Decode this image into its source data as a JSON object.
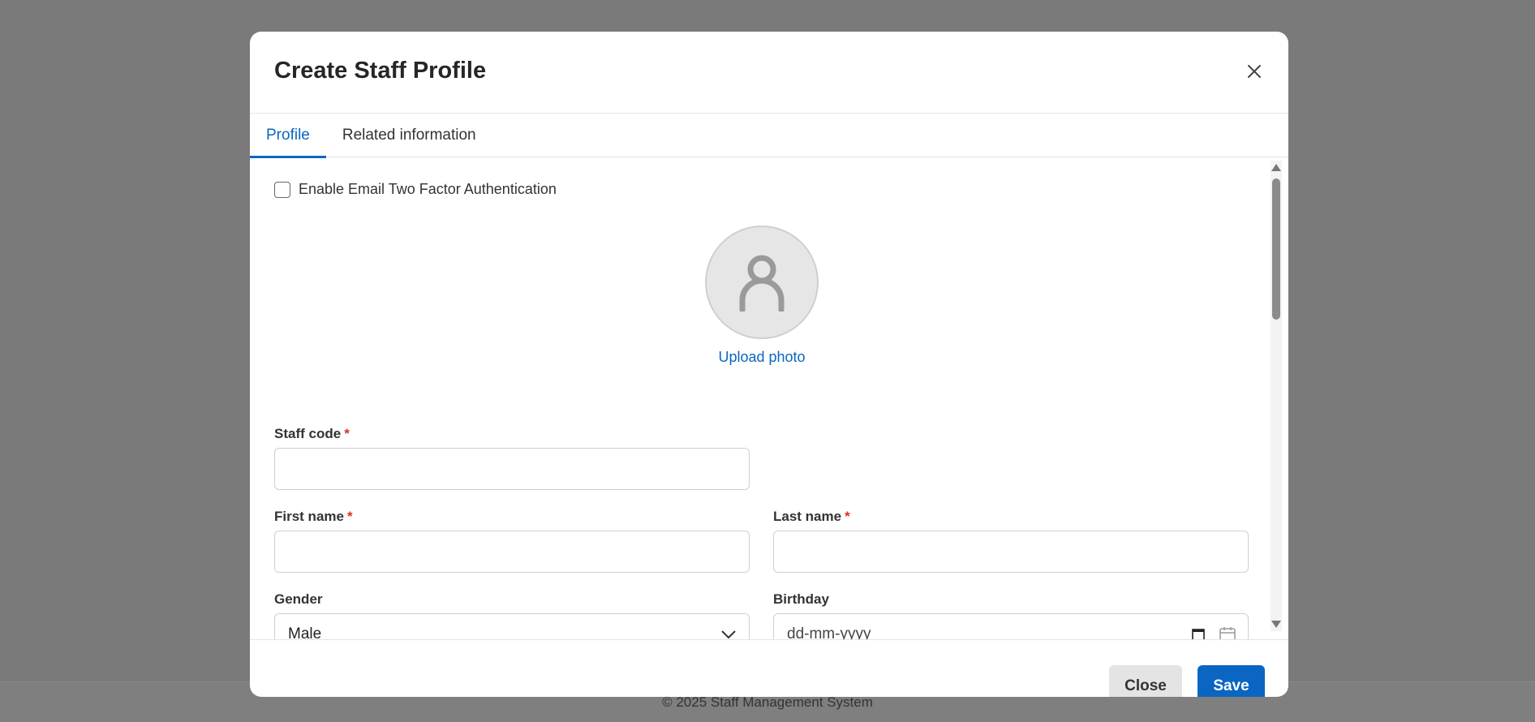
{
  "footer": {
    "text": "© 2025 Staff Management System"
  },
  "modal": {
    "title": "Create Staff Profile",
    "tabs": [
      {
        "label": "Profile",
        "active": true
      },
      {
        "label": "Related information",
        "active": false
      }
    ],
    "two_factor": {
      "label": "Enable Email Two Factor Authentication",
      "checked": false
    },
    "avatar": {
      "icon": "user-icon",
      "upload_label": "Upload photo"
    },
    "fields": {
      "staff_code": {
        "label": "Staff code",
        "required_mark": "*",
        "value": ""
      },
      "first_name": {
        "label": "First name",
        "required_mark": "*",
        "value": ""
      },
      "last_name": {
        "label": "Last name",
        "required_mark": "*",
        "value": ""
      },
      "gender": {
        "label": "Gender",
        "value": "Male"
      },
      "birthday": {
        "label": "Birthday",
        "placeholder": "dd-mm-yyyy"
      }
    },
    "buttons": {
      "close": "Close",
      "save": "Save"
    }
  },
  "colors": {
    "primary": "#0a66c2",
    "required": "#d93025",
    "overlay": "#7a7a7a"
  }
}
